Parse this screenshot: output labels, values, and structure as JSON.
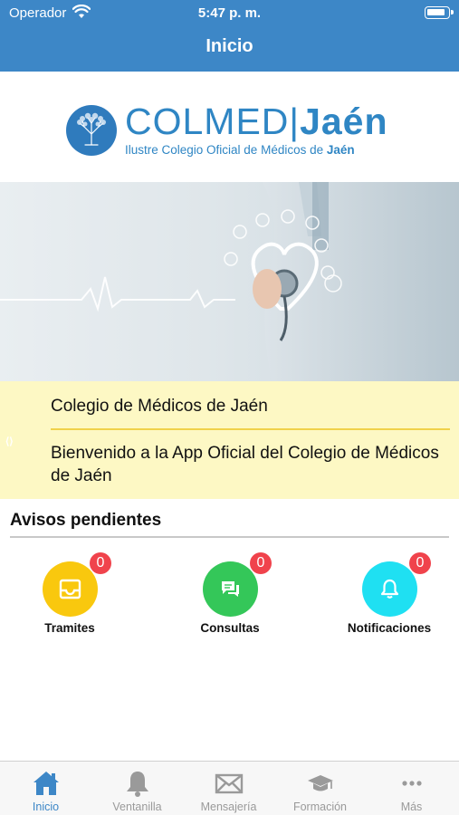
{
  "status_bar": {
    "carrier": "Operador",
    "time": "5:47 p. m."
  },
  "header": {
    "title": "Inicio"
  },
  "logo": {
    "name": "COLMED",
    "separator": "|",
    "city": "Jaén",
    "subtitle": "Ilustre Colegio Oficial de Médicos de",
    "subtitle_city": "Jaén"
  },
  "news": {
    "title": "Colegio de Médicos de Jaén",
    "body": "Bienvenido a la App Oficial del Colegio de Médicos de Jaén"
  },
  "avisos": {
    "title": "Avisos pendientes",
    "items": [
      {
        "label": "Tramites",
        "count": "0",
        "icon": "inbox-icon",
        "color": "#f9c80e"
      },
      {
        "label": "Consultas",
        "count": "0",
        "icon": "chat-icon",
        "color": "#34c759"
      },
      {
        "label": "Notificaciones",
        "count": "0",
        "icon": "bell-icon",
        "color": "#1fe0f2"
      }
    ]
  },
  "tabs": [
    {
      "label": "Inicio",
      "icon": "home-icon",
      "active": true
    },
    {
      "label": "Ventanilla",
      "icon": "bell-icon",
      "active": false
    },
    {
      "label": "Mensajería",
      "icon": "envelope-icon",
      "active": false
    },
    {
      "label": "Formación",
      "icon": "graduation-cap-icon",
      "active": false
    },
    {
      "label": "Más",
      "icon": "more-icon",
      "active": false
    }
  ],
  "colors": {
    "brand": "#3d87c7",
    "badge": "#f0434c",
    "news_bg": "#fdf8c4",
    "tab_inactive": "#9a9a9a"
  }
}
